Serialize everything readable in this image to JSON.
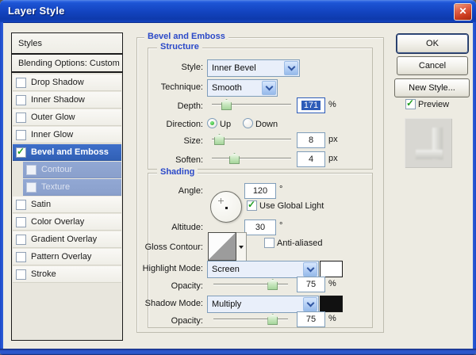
{
  "window": {
    "title": "Layer Style",
    "close_glyph": "✕"
  },
  "sidebar": {
    "header": "Styles",
    "blending_options": "Blending Options: Custom",
    "items": [
      {
        "label": "Drop Shadow",
        "checked": false,
        "state": ""
      },
      {
        "label": "Inner Shadow",
        "checked": false,
        "state": ""
      },
      {
        "label": "Outer Glow",
        "checked": false,
        "state": ""
      },
      {
        "label": "Inner Glow",
        "checked": false,
        "state": ""
      },
      {
        "label": "Bevel and Emboss",
        "checked": true,
        "state": "selected"
      },
      {
        "label": "Contour",
        "checked": false,
        "state": "sub"
      },
      {
        "label": "Texture",
        "checked": false,
        "state": "sub"
      },
      {
        "label": "Satin",
        "checked": false,
        "state": ""
      },
      {
        "label": "Color Overlay",
        "checked": false,
        "state": ""
      },
      {
        "label": "Gradient Overlay",
        "checked": false,
        "state": ""
      },
      {
        "label": "Pattern Overlay",
        "checked": false,
        "state": ""
      },
      {
        "label": "Stroke",
        "checked": false,
        "state": ""
      }
    ]
  },
  "main": {
    "panel_title": "Bevel and Emboss",
    "structure": {
      "title": "Structure",
      "style_label": "Style:",
      "style_value": "Inner Bevel",
      "technique_label": "Technique:",
      "technique_value": "Smooth",
      "depth_label": "Depth:",
      "depth_value": "171",
      "depth_unit": "%",
      "direction_label": "Direction:",
      "direction_up": "Up",
      "direction_down": "Down",
      "direction_selected": "up",
      "size_label": "Size:",
      "size_value": "8",
      "size_unit": "px",
      "soften_label": "Soften:",
      "soften_value": "4",
      "soften_unit": "px"
    },
    "shading": {
      "title": "Shading",
      "angle_label": "Angle:",
      "angle_value": "120",
      "angle_unit": "°",
      "use_global_light_label": "Use Global Light",
      "altitude_label": "Altitude:",
      "altitude_value": "30",
      "altitude_unit": "°",
      "gloss_contour_label": "Gloss Contour:",
      "anti_aliased_label": "Anti-aliased",
      "highlight_mode_label": "Highlight Mode:",
      "highlight_mode_value": "Screen",
      "opacity_label": "Opacity:",
      "highlight_opacity_value": "75",
      "opacity_unit": "%",
      "shadow_mode_label": "Shadow Mode:",
      "shadow_mode_value": "Multiply",
      "shadow_opacity_value": "75"
    }
  },
  "actions": {
    "ok": "OK",
    "cancel": "Cancel",
    "new_style": "New Style...",
    "preview": "Preview"
  },
  "checks": {
    "use_global_light": true,
    "anti_aliased": false,
    "preview": true
  },
  "sliders": {
    "depth": 17,
    "size": 8,
    "soften": 27,
    "highlight_opacity": 78,
    "shadow_opacity": 78
  },
  "colors": {
    "highlight_swatch": "#FFFFFF",
    "shadow_swatch": "#111111"
  }
}
